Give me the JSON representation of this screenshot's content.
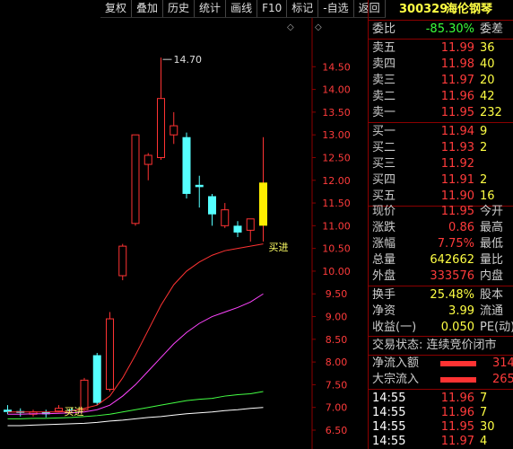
{
  "toolbar": [
    "复权",
    "叠加",
    "历史",
    "统计",
    "画线",
    "F10",
    "标记",
    "-自选",
    "返回"
  ],
  "stock": {
    "code": "300329",
    "name": "海伦钢琴"
  },
  "weibi": {
    "label": "委比",
    "value": "-85.30%",
    "label2": "委差"
  },
  "sell": [
    {
      "label": "卖五",
      "price": "11.99",
      "vol": "36"
    },
    {
      "label": "卖四",
      "price": "11.98",
      "vol": "40"
    },
    {
      "label": "卖三",
      "price": "11.97",
      "vol": "20"
    },
    {
      "label": "卖二",
      "price": "11.96",
      "vol": "42"
    },
    {
      "label": "卖一",
      "price": "11.95",
      "vol": "232"
    }
  ],
  "buy": [
    {
      "label": "买一",
      "price": "11.94",
      "vol": "9"
    },
    {
      "label": "买二",
      "price": "11.93",
      "vol": "2"
    },
    {
      "label": "买三",
      "price": "11.92",
      "vol": ""
    },
    {
      "label": "买四",
      "price": "11.91",
      "vol": "2"
    },
    {
      "label": "买五",
      "price": "11.90",
      "vol": "16"
    }
  ],
  "quote": [
    {
      "k": "现价",
      "v": "11.95",
      "k2": "今开"
    },
    {
      "k": "涨跌",
      "v": "0.86",
      "k2": "最高"
    },
    {
      "k": "涨幅",
      "v": "7.75%",
      "k2": "最低"
    },
    {
      "k": "总量",
      "v": "642662",
      "k2": "量比"
    },
    {
      "k": "外盘",
      "v": "333576",
      "k2": "内盘"
    }
  ],
  "info": [
    {
      "k": "换手",
      "v": "25.48%",
      "k2": "股本"
    },
    {
      "k": "净资",
      "v": "3.99",
      "k2": "流通"
    },
    {
      "k": "收益(一)",
      "v": "0.050",
      "k2": "PE(动)"
    }
  ],
  "status": "交易状态: 连续竞价闭市",
  "flows": [
    {
      "label": "净流入额",
      "val": "314"
    },
    {
      "label": "大宗流入",
      "val": "265"
    }
  ],
  "ticks": [
    {
      "time": "14:55",
      "price": "11.96",
      "vol": "7"
    },
    {
      "time": "14:55",
      "price": "11.96",
      "vol": "7"
    },
    {
      "time": "14:55",
      "price": "11.95",
      "vol": "30"
    },
    {
      "time": "14:55",
      "price": "11.97",
      "vol": "4"
    }
  ],
  "chart_data": {
    "type": "candlestick",
    "ylim": [
      6.5,
      15.0
    ],
    "yticks": [
      "14.50",
      "14.00",
      "13.50",
      "13.00",
      "12.50",
      "12.00",
      "11.50",
      "11.00",
      "10.50",
      "10.00",
      "9.50",
      "9.00",
      "8.50",
      "8.00",
      "7.50",
      "7.00",
      "6.50"
    ],
    "annotations": {
      "high_label": "14.70",
      "buy_label_1": "买进",
      "buy_label_2": "买进"
    },
    "candles": [
      {
        "o": 6.95,
        "c": 6.9,
        "h": 7.05,
        "l": 6.85,
        "up": false
      },
      {
        "o": 6.92,
        "c": 6.88,
        "h": 6.98,
        "l": 6.8,
        "up": false
      },
      {
        "o": 6.85,
        "c": 6.9,
        "h": 6.95,
        "l": 6.8,
        "up": true
      },
      {
        "o": 6.9,
        "c": 6.85,
        "h": 6.95,
        "l": 6.78,
        "up": false
      },
      {
        "o": 6.92,
        "c": 6.98,
        "h": 7.05,
        "l": 6.9,
        "up": true
      },
      {
        "o": 6.95,
        "c": 6.92,
        "h": 7.0,
        "l": 6.88,
        "up": false
      },
      {
        "o": 6.95,
        "c": 7.6,
        "h": 7.65,
        "l": 6.92,
        "up": true
      },
      {
        "o": 8.15,
        "c": 7.1,
        "h": 8.2,
        "l": 7.05,
        "up": false
      },
      {
        "o": 7.4,
        "c": 8.95,
        "h": 9.1,
        "l": 7.35,
        "up": true
      },
      {
        "o": 9.9,
        "c": 10.55,
        "h": 10.6,
        "l": 9.8,
        "up": true
      },
      {
        "o": 11.05,
        "c": 13.0,
        "h": 13.0,
        "l": 11.0,
        "up": true
      },
      {
        "o": 12.35,
        "c": 12.55,
        "h": 12.6,
        "l": 12.0,
        "up": true
      },
      {
        "o": 12.5,
        "c": 13.8,
        "h": 14.7,
        "l": 12.45,
        "up": true
      },
      {
        "o": 13.0,
        "c": 13.2,
        "h": 13.5,
        "l": 12.8,
        "up": true
      },
      {
        "o": 12.95,
        "c": 11.7,
        "h": 13.05,
        "l": 11.6,
        "up": false
      },
      {
        "o": 11.9,
        "c": 11.85,
        "h": 12.1,
        "l": 11.4,
        "up": false
      },
      {
        "o": 11.65,
        "c": 11.25,
        "h": 11.7,
        "l": 11.0,
        "up": false
      },
      {
        "o": 11.0,
        "c": 11.35,
        "h": 11.5,
        "l": 10.95,
        "up": true
      },
      {
        "o": 11.0,
        "c": 10.85,
        "h": 11.1,
        "l": 10.75,
        "up": false
      },
      {
        "o": 10.9,
        "c": 11.15,
        "h": 11.15,
        "l": 10.65,
        "up": true
      },
      {
        "o": 11.0,
        "c": 11.95,
        "h": 12.95,
        "l": 10.65,
        "up": true,
        "highlight": true
      }
    ],
    "ma": [
      {
        "color": "#ff3333",
        "values": [
          6.9,
          6.9,
          6.9,
          6.9,
          6.9,
          6.92,
          6.98,
          7.05,
          7.25,
          7.65,
          8.15,
          8.7,
          9.25,
          9.7,
          10.0,
          10.2,
          10.35,
          10.45,
          10.5,
          10.55,
          10.6
        ]
      },
      {
        "color": "#ff44ff",
        "values": [
          6.85,
          6.85,
          6.86,
          6.86,
          6.87,
          6.88,
          6.9,
          6.95,
          7.05,
          7.25,
          7.5,
          7.8,
          8.1,
          8.4,
          8.65,
          8.85,
          9.0,
          9.1,
          9.2,
          9.32,
          9.5
        ]
      },
      {
        "color": "#44ff44",
        "values": [
          6.75,
          6.75,
          6.76,
          6.76,
          6.77,
          6.78,
          6.8,
          6.82,
          6.85,
          6.9,
          6.95,
          7.0,
          7.05,
          7.1,
          7.15,
          7.18,
          7.2,
          7.25,
          7.28,
          7.3,
          7.35
        ]
      },
      {
        "color": "#ffffff",
        "values": [
          6.6,
          6.6,
          6.61,
          6.62,
          6.63,
          6.64,
          6.65,
          6.67,
          6.7,
          6.72,
          6.75,
          6.78,
          6.8,
          6.83,
          6.86,
          6.88,
          6.9,
          6.93,
          6.95,
          6.98,
          7.0
        ]
      }
    ]
  }
}
